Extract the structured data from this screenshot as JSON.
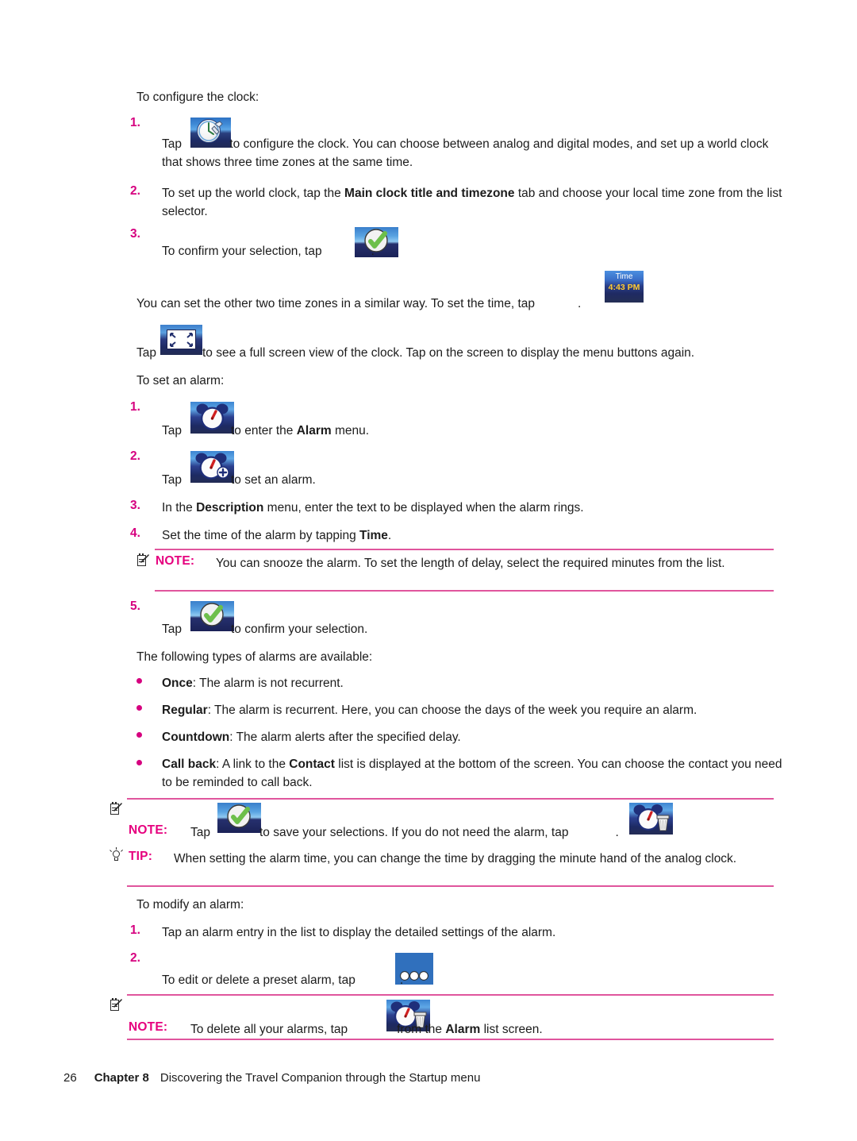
{
  "document": {
    "type": "user-manual-page",
    "page_number": "26",
    "chapter_label": "Chapter 8",
    "chapter_title": "Discovering the Travel Companion through the Startup menu"
  },
  "colors": {
    "accent_pink": "#d6007f",
    "note_label": "#e6007e",
    "rule": "#e0559d",
    "body_text": "#1c1c1c",
    "tile_blue": "#3070bd"
  },
  "sections": {
    "configure_clock": {
      "intro": "To configure the clock:",
      "steps": [
        {
          "number": "1.",
          "icon": "clock-settings-icon",
          "text_before": "Tap",
          "text_after": "to configure the clock. You can choose between analog and digital modes, and set up a world clock that shows three time zones at the same time."
        },
        {
          "number": "2.",
          "text_a": "To set up the world clock, tap the ",
          "bold_b": "Main clock title and timezone",
          "text_c": " tab and choose your local time zone from the list selector."
        },
        {
          "number": "3.",
          "icon": "confirm-check-icon",
          "text_before": "To confirm your selection, tap",
          "text_after": "."
        }
      ]
    },
    "time_zone_para": {
      "text_before": "You can set the other two time zones in a similar way. To set the time, tap",
      "icon": "time-button-icon",
      "icon_label_top": "Time",
      "icon_label_bottom": "4:43 PM",
      "text_after": "."
    },
    "fullscreen_para": {
      "text_before": "Tap",
      "icon": "fullscreen-icon",
      "text_after": "to see a full screen view of the clock. Tap on the screen to display the menu buttons again."
    },
    "set_alarm": {
      "intro": "To set an alarm:",
      "steps": [
        {
          "number": "1.",
          "icon": "alarm-clock-icon",
          "text_before": "Tap",
          "text_mid": "to enter the ",
          "bold": "Alarm",
          "text_after": " menu."
        },
        {
          "number": "2.",
          "icon": "add-alarm-icon",
          "text_before": "Tap",
          "text_after": "to set an alarm."
        },
        {
          "number": "3.",
          "text_a": "In the ",
          "bold_b": "Description",
          "text_c": " menu, enter the text to be displayed when the alarm rings."
        },
        {
          "number": "4.",
          "text_a": "Set the time of the alarm by tapping ",
          "bold_b": "Time",
          "text_c": "."
        }
      ]
    },
    "note_snooze": {
      "label": "NOTE:",
      "text": "You can snooze the alarm. To set the length of delay, select the required minutes from the list."
    },
    "step5": {
      "number": "5.",
      "icon": "confirm-check-icon",
      "text_before": "Tap",
      "text_after": "to confirm your selection."
    },
    "alarm_types": {
      "intro": "The following types of alarms are available:",
      "items": [
        {
          "term": "Once",
          "desc": ": The alarm is not recurrent."
        },
        {
          "term": "Regular",
          "desc": ": The alarm is recurrent. Here, you can choose the days of the week you require an alarm."
        },
        {
          "term": "Countdown",
          "desc": ": The alarm alerts after the specified delay."
        },
        {
          "term": "Call back",
          "desc_a": ": A link to the ",
          "bold_b": "Contact",
          "desc_c": " list is displayed at the bottom of the screen. You can choose the contact you need to be reminded to call back."
        }
      ]
    },
    "note_save": {
      "label": "NOTE:",
      "text_a": "Tap",
      "icon_a": "confirm-check-icon",
      "text_b": "to save your selections. If you do not need the alarm, tap",
      "icon_b": "delete-alarm-icon",
      "text_c": "."
    },
    "tip_drag": {
      "label": "TIP:",
      "text": "When setting the alarm time, you can change the time by dragging the minute hand of the analog clock."
    },
    "modify_alarm": {
      "intro": "To modify an alarm:",
      "steps": [
        {
          "number": "1.",
          "text": "Tap an alarm entry in the list to display the detailed settings of the alarm."
        },
        {
          "number": "2.",
          "icon": "more-options-icon",
          "text_before": "To edit or delete a preset alarm, tap",
          "text_after": "."
        }
      ]
    },
    "note_delete_all": {
      "label": "NOTE:",
      "text_a": "To delete all your alarms, tap",
      "icon": "delete-alarm-icon",
      "text_b": "from the ",
      "bold_c": "Alarm",
      "text_d": " list screen."
    }
  }
}
